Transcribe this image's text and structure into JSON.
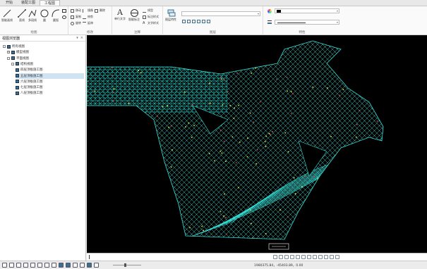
{
  "tabs": [
    {
      "label": "开始",
      "active": false
    },
    {
      "label": "装配工图",
      "active": false
    },
    {
      "label": "工程图",
      "active": true
    }
  ],
  "ribbon": {
    "draw": {
      "group_label": "绘图",
      "tools": [
        "智能画线",
        "直线",
        "多段线",
        "圆",
        "圆弧"
      ]
    },
    "modify": {
      "group_label": "修改",
      "rows": [
        [
          "移动",
          "镜像",
          "删除"
        ],
        [
          "复制",
          "修剪"
        ],
        [
          "旋转",
          "延伸"
        ]
      ]
    },
    "annotation": {
      "group_label": "注释",
      "tools": [
        "单行文字",
        "智能标注"
      ],
      "rows": [
        "线型",
        "标注样式",
        "文字样式"
      ]
    },
    "layer": {
      "group_label": "图层",
      "tool": "图层特性"
    },
    "properties": {
      "group_label": "特性"
    }
  },
  "panel": {
    "title": "视图浏览器",
    "tree": [
      {
        "label": "所有视图",
        "level": 0,
        "toggle": "-",
        "selected": false
      },
      {
        "label": "模型视图",
        "level": 1,
        "toggle": "+",
        "selected": false
      },
      {
        "label": "平面视图",
        "level": 1,
        "toggle": "-",
        "selected": false
      },
      {
        "label": "结构视图",
        "level": 2,
        "toggle": "-",
        "selected": false
      },
      {
        "label": "四层顶板施工图",
        "level": 3,
        "toggle": "",
        "selected": false
      },
      {
        "label": "五层顶板施工图",
        "level": 3,
        "toggle": "",
        "selected": true
      },
      {
        "label": "六层顶板施工图",
        "level": 3,
        "toggle": "",
        "selected": false
      },
      {
        "label": "七层顶板施工图",
        "level": 3,
        "toggle": "",
        "selected": false
      },
      {
        "label": "八层顶板施工图",
        "level": 3,
        "toggle": "",
        "selected": false
      }
    ]
  },
  "status": {
    "coords": "1980375.84，-45403.89，0.00"
  },
  "colors": {
    "accent": "#3f6f8f",
    "drawing_lines": "#35e0d8",
    "drawing_accent": "#e8e840",
    "drawing_red": "#e04040",
    "canvas_bg": "#000000"
  }
}
